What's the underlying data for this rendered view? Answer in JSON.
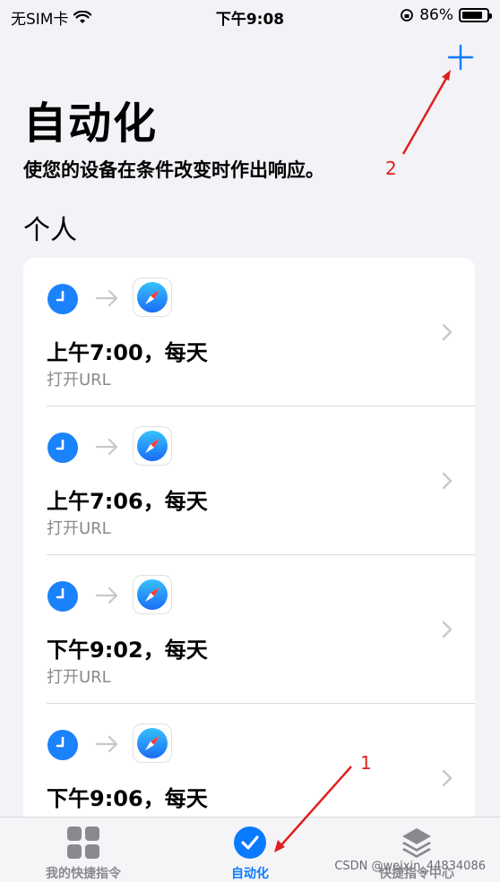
{
  "status": {
    "carrier": "无SIM卡",
    "time": "下午9:08",
    "battery_percent": "86%",
    "battery_level": 0.86
  },
  "header": {
    "title": "自动化",
    "subtitle": "使您的设备在条件改变时作出响应。",
    "section": "个人"
  },
  "automations": [
    {
      "title": "上午7:00，每天",
      "action": "打开URL",
      "trigger_icon": "clock-icon",
      "action_icon": "safari-icon"
    },
    {
      "title": "上午7:06，每天",
      "action": "打开URL",
      "trigger_icon": "clock-icon",
      "action_icon": "safari-icon"
    },
    {
      "title": "下午9:02，每天",
      "action": "打开URL",
      "trigger_icon": "clock-icon",
      "action_icon": "safari-icon"
    },
    {
      "title": "下午9:06，每天",
      "action": "",
      "trigger_icon": "clock-icon",
      "action_icon": "safari-icon"
    }
  ],
  "tabs": [
    {
      "label": "我的快捷指令",
      "icon": "grid-icon",
      "active": false
    },
    {
      "label": "自动化",
      "icon": "check-clock-icon",
      "active": true
    },
    {
      "label": "快捷指令中心",
      "icon": "layers-icon",
      "active": false
    }
  ],
  "annotations": {
    "one": "1",
    "two": "2"
  },
  "watermark": "CSDN @weixin_44834086",
  "colors": {
    "accent": "#0a7aff",
    "annotation": "#e02020",
    "clock": "#1a82fb"
  }
}
